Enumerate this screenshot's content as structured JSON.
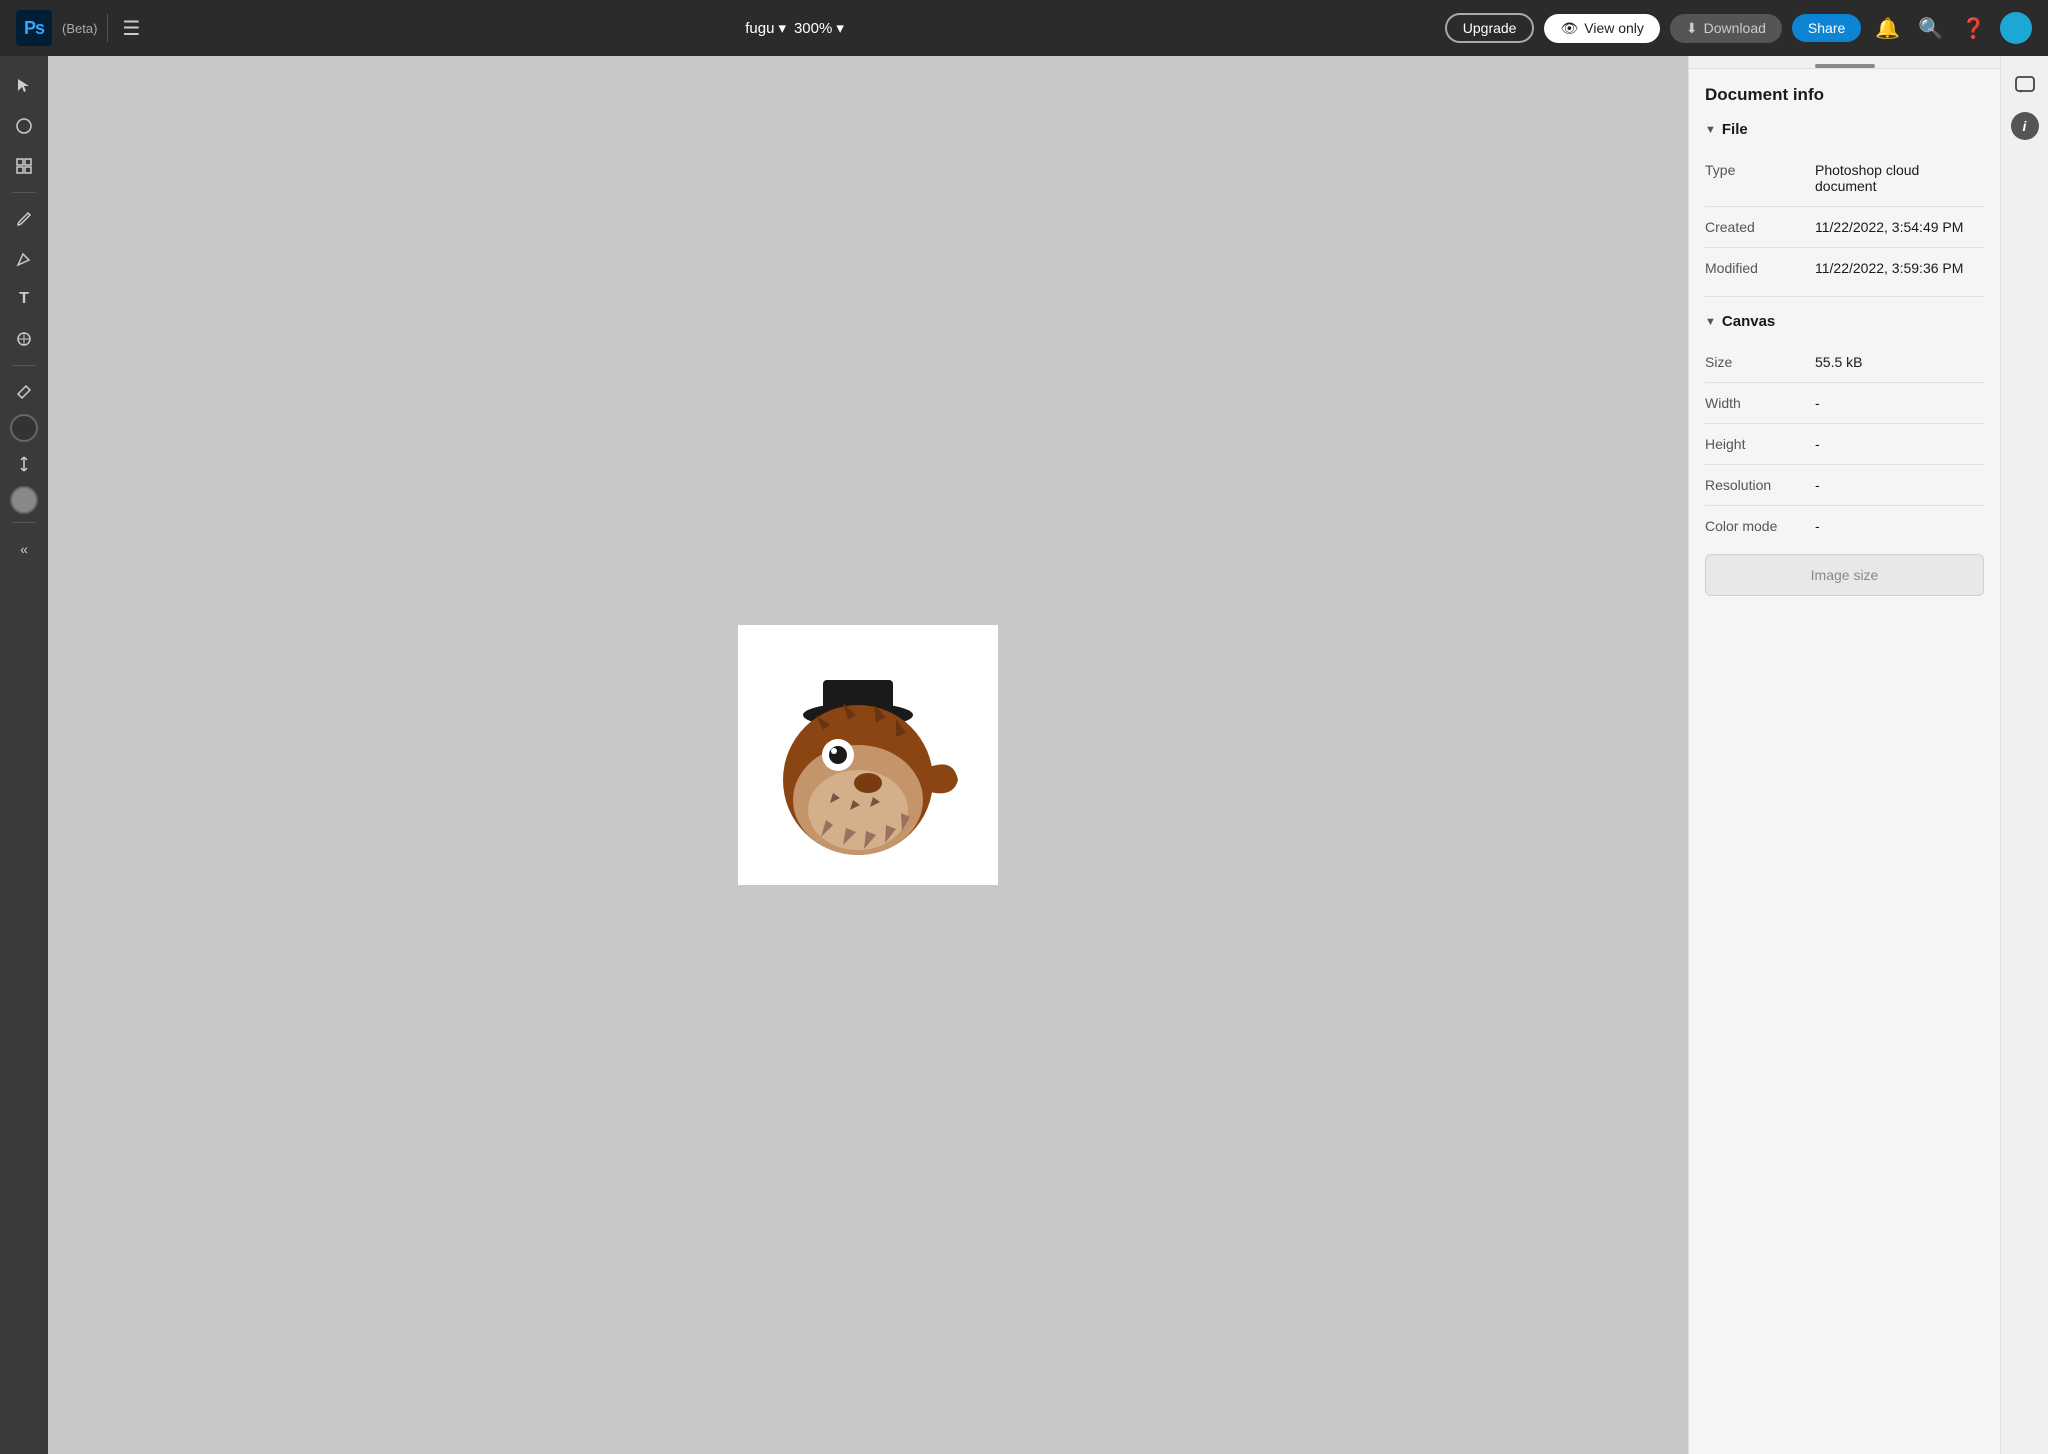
{
  "topbar": {
    "logo": "Ps",
    "beta": "(Beta)",
    "filename": "fugu",
    "zoom": "300%",
    "upgrade_label": "Upgrade",
    "viewonly_label": "View only",
    "download_label": "Download",
    "share_label": "Share"
  },
  "toolbar": {
    "tools": [
      {
        "name": "select-tool",
        "icon": "↖"
      },
      {
        "name": "crop-tool",
        "icon": "◯"
      },
      {
        "name": "transform-tool",
        "icon": "⊞"
      },
      {
        "name": "brush-tool",
        "icon": "✏"
      },
      {
        "name": "pen-tool",
        "icon": "✒"
      },
      {
        "name": "type-tool",
        "icon": "T"
      },
      {
        "name": "shape-tool",
        "icon": "⊕"
      },
      {
        "name": "eyedropper-tool",
        "icon": "✦"
      },
      {
        "name": "scroll-tool",
        "icon": "↕"
      }
    ]
  },
  "panel": {
    "title": "Document info",
    "file_section_label": "File",
    "file_rows": [
      {
        "label": "Type",
        "value": "Photoshop cloud document"
      },
      {
        "label": "Created",
        "value": "11/22/2022, 3:54:49 PM"
      },
      {
        "label": "Modified",
        "value": "11/22/2022, 3:59:36 PM"
      }
    ],
    "canvas_section_label": "Canvas",
    "canvas_rows": [
      {
        "label": "Size",
        "value": "55.5 kB"
      },
      {
        "label": "Width",
        "value": "-"
      },
      {
        "label": "Height",
        "value": "-"
      },
      {
        "label": "Resolution",
        "value": "-"
      },
      {
        "label": "Color mode",
        "value": "-"
      }
    ],
    "image_size_btn": "Image size"
  },
  "far_right": {
    "comment_icon": "💬",
    "info_icon": "i"
  }
}
